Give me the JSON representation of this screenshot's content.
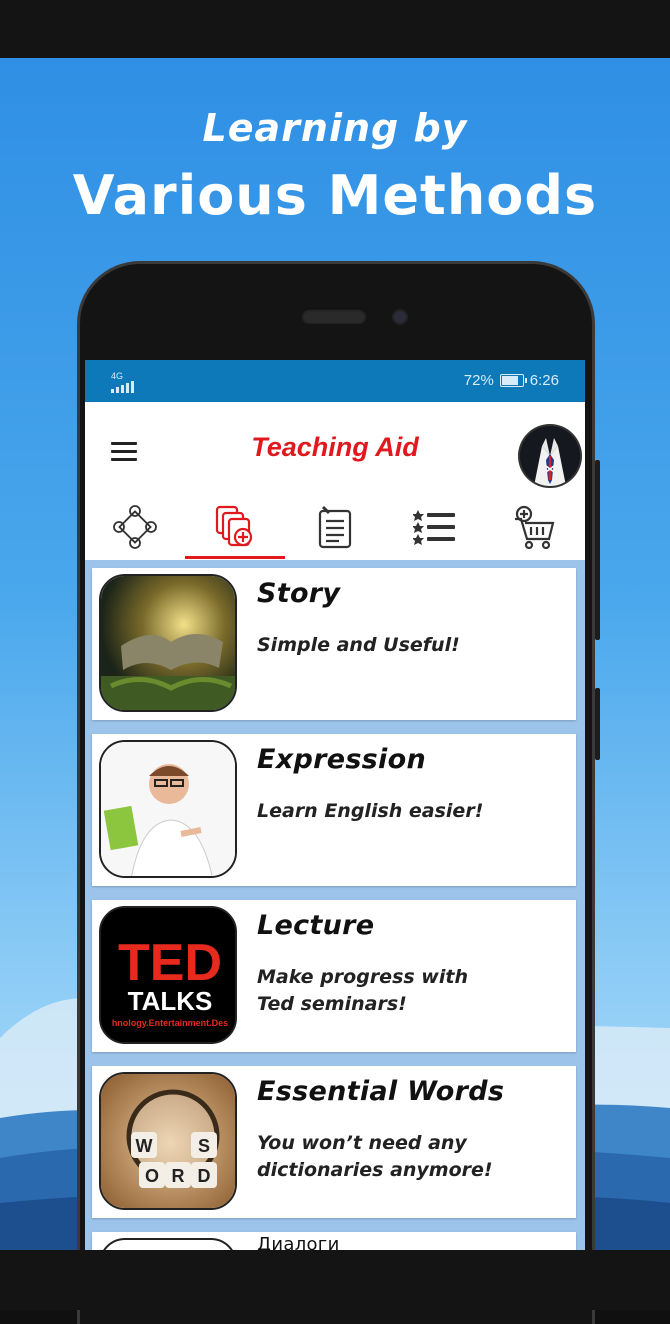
{
  "promo": {
    "headline_line1": "Learning by",
    "headline_line2": "Various Methods"
  },
  "status_bar": {
    "network": "4G",
    "battery": "72%",
    "time": "6:26"
  },
  "app_bar": {
    "title": "Teaching Aid"
  },
  "tabs": [
    {
      "icon": "skills-wheel-icon",
      "selected": false
    },
    {
      "icon": "add-cards-icon",
      "selected": true
    },
    {
      "icon": "notes-icon",
      "selected": false
    },
    {
      "icon": "ranked-list-icon",
      "selected": false
    },
    {
      "icon": "cart-add-icon",
      "selected": false
    }
  ],
  "cards": [
    {
      "title": "Story",
      "subtitle": "Simple and Useful!"
    },
    {
      "title": "Expression",
      "subtitle": "Learn English easier!"
    },
    {
      "title": "Lecture",
      "subtitle": "Make progress with\nTed seminars!",
      "thumb_text_1": "TED",
      "thumb_text_2": "TALKS",
      "thumb_text_3": "hnology.Entertainment.Des"
    },
    {
      "title": "Essential Words",
      "subtitle": "You won’t need any\ndictionaries anymore!",
      "thumb_letters": [
        "W",
        "S",
        "O",
        "R",
        "D"
      ]
    },
    {
      "title": "Диалоги"
    }
  ],
  "colors": {
    "accent_red": "#e0191e",
    "status_blue": "#0d79b8",
    "list_background": "#9cc3ea"
  }
}
